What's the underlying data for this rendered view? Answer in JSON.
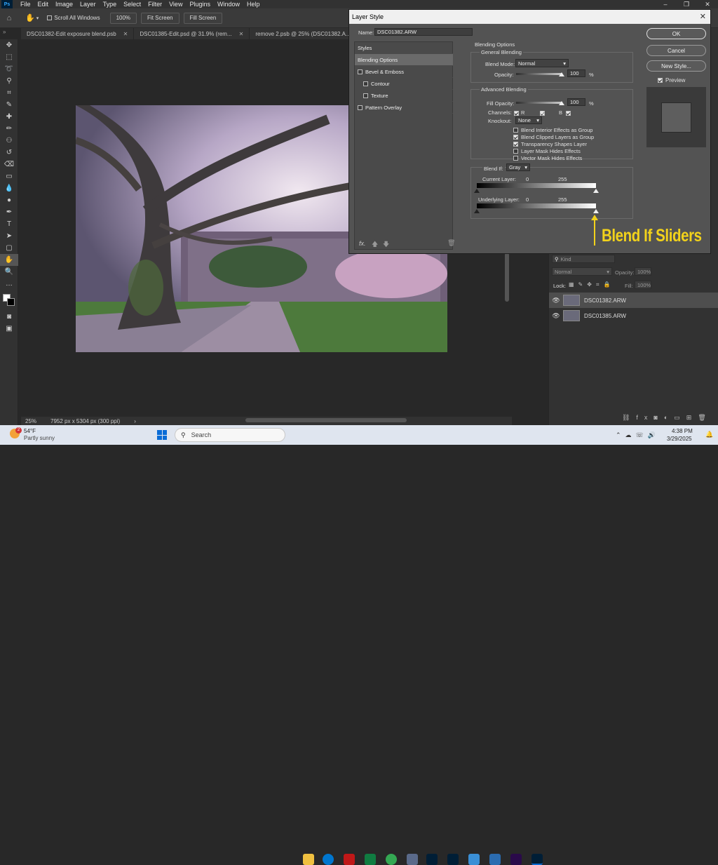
{
  "menubar": {
    "items": [
      "File",
      "Edit",
      "Image",
      "Layer",
      "Type",
      "Select",
      "Filter",
      "View",
      "Plugins",
      "Window",
      "Help"
    ]
  },
  "optionsbar": {
    "scroll_all_label": "Scroll All Windows",
    "zoom_btn": "100%",
    "fit_screen": "Fit Screen",
    "fill_screen": "Fill Screen"
  },
  "tabs": [
    {
      "label": "DSC01382-Edit exposure blend.psb"
    },
    {
      "label": "DSC01385-Edit.psd @ 31.9% (rem..."
    },
    {
      "label": "remove 2.psb @ 25% (DSC01382.A..."
    }
  ],
  "status": {
    "zoom": "25%",
    "info": "7952 px x 5304 px (300 ppi)"
  },
  "layers": {
    "search_placeholder": "Kind",
    "blend_mode": "Normal",
    "opacity_label": "Opacity:",
    "opacity_value": "100%",
    "lock_label": "Lock:",
    "fill_label": "Fill:",
    "fill_value": "100%",
    "items": [
      {
        "name": "DSC01382.ARW",
        "selected": true
      },
      {
        "name": "DSC01385.ARW",
        "selected": false
      }
    ]
  },
  "dialog": {
    "title": "Layer Style",
    "name_label": "Name:",
    "name_value": "DSC01382.ARW",
    "styles_header": "Styles",
    "styles": [
      {
        "label": "Blending Options",
        "selected": true,
        "checkbox": false
      },
      {
        "label": "Bevel & Emboss",
        "selected": false,
        "checkbox": true
      },
      {
        "label": "Contour",
        "selected": false,
        "checkbox": true
      },
      {
        "label": "Texture",
        "selected": false,
        "checkbox": true
      },
      {
        "label": "Pattern Overlay",
        "selected": false,
        "checkbox": true
      }
    ],
    "fx_label": "fx.",
    "section_title": "Blending Options",
    "general_title": "General Blending",
    "blend_mode_label": "Blend Mode:",
    "blend_mode_value": "Normal",
    "opacity_label": "Opacity:",
    "opacity_value": "100",
    "pct": "%",
    "advanced_title": "Advanced Blending",
    "fill_opacity_label": "Fill Opacity:",
    "fill_opacity_value": "100",
    "channels_label": "Channels:",
    "channels": [
      "R",
      "G",
      "B"
    ],
    "knockout_label": "Knockout:",
    "knockout_value": "None",
    "options": [
      {
        "label": "Blend Interior Effects as Group",
        "checked": false
      },
      {
        "label": "Blend Clipped Layers as Group",
        "checked": true
      },
      {
        "label": "Transparency Shapes Layer",
        "checked": true
      },
      {
        "label": "Layer Mask Hides Effects",
        "checked": false
      },
      {
        "label": "Vector Mask Hides Effects",
        "checked": false
      }
    ],
    "blend_if_label": "Blend If:",
    "blend_if_value": "Gray",
    "current_layer_label": "Current Layer:",
    "underlying_layer_label": "Underlying Layer:",
    "range_low": "0",
    "range_high": "255",
    "ok": "OK",
    "cancel": "Cancel",
    "new_style": "New Style...",
    "preview_label": "Preview"
  },
  "annotation": {
    "text": "Blend If Sliders",
    "color": "#f2d21b"
  },
  "taskbar": {
    "weather_temp": "54°F",
    "weather_desc": "Partly sunny",
    "search_placeholder": "Search",
    "time": "4:38 PM",
    "date": "3/29/2025",
    "notif_count": "2"
  }
}
